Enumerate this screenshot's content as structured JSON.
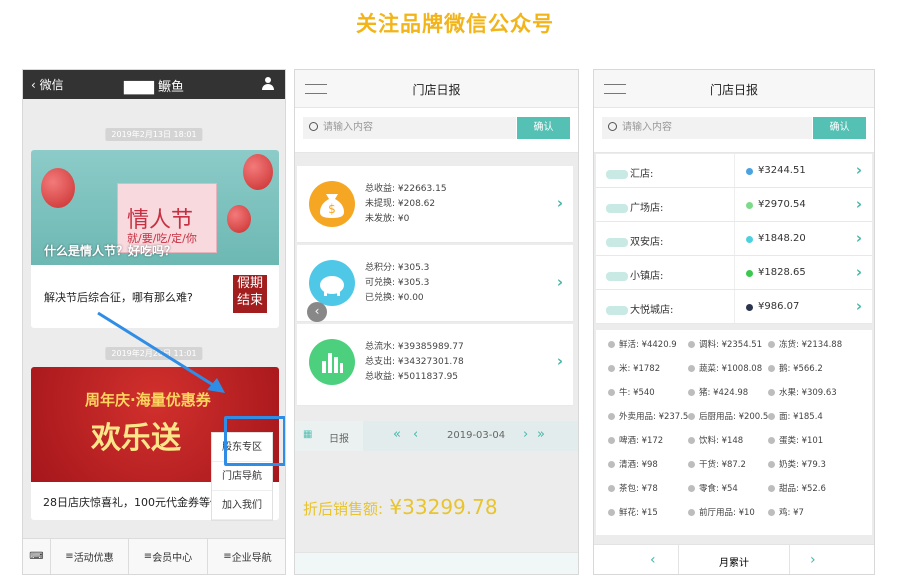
{
  "headline": "关注品牌微信公众号",
  "wechat": {
    "back": "微信",
    "title": "▇▇▇ 鳜鱼",
    "date1": "2019年2月13日 18:01",
    "card1_art_title": "情人节",
    "card1_art_sub": "就/要/吃/定/你",
    "card1_caption": "什么是情人节？好吃吗？",
    "card1_sub": "解决节后综合征，哪有那么难?",
    "holiday_badge": "假期结束",
    "date2": "2019年2月28日 11:01",
    "card2_art_top": "周年庆·海量优惠券",
    "card2_art_big": "欢乐送",
    "card2_caption": "28日店庆惊喜礼，100元代金券等你",
    "popup": [
      "股东专区",
      "门店导航",
      "加入我们"
    ],
    "tabs": [
      "活动优惠",
      "会员中心",
      "企业导航"
    ]
  },
  "report": {
    "title": "门店日报",
    "search_placeholder": "请输入内容",
    "search_button": "确认",
    "blocks": [
      {
        "icon": "money-bag-icon",
        "color": "#f5a623",
        "lines": [
          "总收益: ¥22663.15",
          "未提现: ¥208.62",
          "未发放: ¥0"
        ]
      },
      {
        "icon": "piggy-bank-icon",
        "color": "#4fc8e8",
        "lines": [
          "总积分: ¥305.3",
          "可兑换: ¥305.3",
          "已兑换: ¥0.00"
        ]
      },
      {
        "icon": "bar-chart-icon",
        "color": "#4cd07d",
        "lines": [
          "总流水: ¥39385989.77",
          "总支出: ¥34327301.78",
          "总收益: ¥5011837.95"
        ]
      }
    ],
    "daily_label": "日报",
    "date": "2019-03-04",
    "sale_label": "折后销售额:",
    "sale_value": "¥33299.78"
  },
  "report2": {
    "title": "门店日报",
    "search_placeholder": "请输入内容",
    "search_button": "确认",
    "stores": [
      {
        "name": "汇店:",
        "value": "¥3244.51",
        "color": "#4aa3df"
      },
      {
        "name": "广场店:",
        "value": "¥2970.54",
        "color": "#7ed98a"
      },
      {
        "name": "双安店:",
        "value": "¥1848.20",
        "color": "#4fd0e0"
      },
      {
        "name": "小镇店:",
        "value": "¥1828.65",
        "color": "#3cc850"
      },
      {
        "name": "大悦城店:",
        "value": "¥986.07",
        "color": "#2b3550"
      }
    ],
    "categories": [
      [
        "鲜活: ¥4420.9",
        "调料: ¥2354.51",
        "冻货: ¥2134.88"
      ],
      [
        "米: ¥1782",
        "蔬菜: ¥1008.08",
        "鹅: ¥566.2"
      ],
      [
        "牛: ¥540",
        "猪: ¥424.98",
        "水果: ¥309.63"
      ],
      [
        "外卖用品: ¥237.5",
        "后厨用品: ¥200.5",
        "面: ¥185.4"
      ],
      [
        "啤酒: ¥172",
        "饮料: ¥148",
        "蛋类: ¥101"
      ],
      [
        "清酒: ¥98",
        "干货: ¥87.2",
        "奶类: ¥79.3"
      ],
      [
        "茶包: ¥78",
        "零食: ¥54",
        "甜品: ¥52.6"
      ],
      [
        "鲜花: ¥15",
        "前厅用品: ¥10",
        "鸡: ¥7"
      ]
    ],
    "month_label": "月累计"
  }
}
